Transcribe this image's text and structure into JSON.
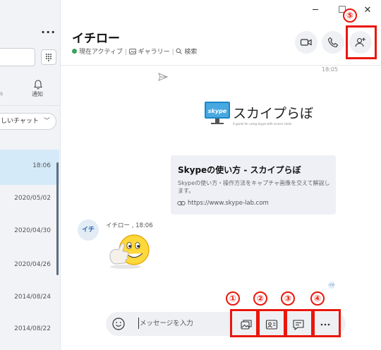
{
  "window": {
    "minimize": "─",
    "maximize": "☐",
    "close": "✕"
  },
  "sidebar": {
    "more": "···",
    "tab_left_partial": "s",
    "notifications_label": "通知",
    "new_chat_label": "しいチャット",
    "chat_dates": [
      "18:06",
      "2020/05/02",
      "2020/04/30",
      "2020/04/26",
      "2014/08/24",
      "2014/08/22"
    ]
  },
  "header": {
    "title": "イチロー",
    "status": "現在アクティブ",
    "gallery": "ギャラリー",
    "search": "検索"
  },
  "messages": {
    "top_time": "18:05",
    "logo_brand": "skype",
    "logo_text": "スカイプらぼ",
    "logo_tagline": "A guide for using skype with screen shots",
    "card": {
      "title": "Skypeの使い方 - スカイプらぼ",
      "description": "Skypeの使い方・操作方法をキャプチャ画像を交えて解説します。",
      "url": "https://www.skype-lab.com"
    },
    "avatar_initials": "イチ",
    "sender_line": "イチロー , 18:06",
    "seen_initials": "イチ"
  },
  "composer": {
    "placeholder": "メッセージを入力"
  },
  "annotations": [
    "①",
    "②",
    "③",
    "④",
    "⑤"
  ],
  "colors": {
    "accent": "#e8170c",
    "active": "#3aa35a",
    "selected_row": "#d5eaf9"
  }
}
